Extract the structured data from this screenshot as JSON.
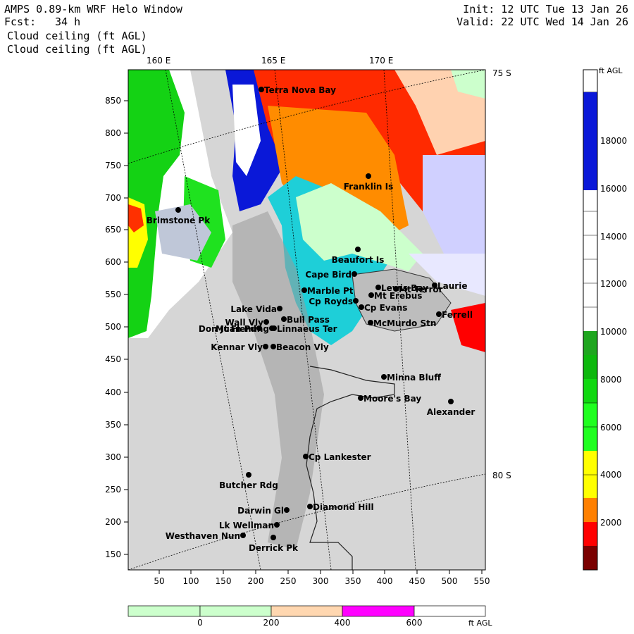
{
  "header": {
    "title": "AMPS 0.89-km WRF Helo Window",
    "forecast_label": "Fcst:",
    "forecast_hours": "34 h",
    "field_line1": "Cloud ceiling (ft AGL)",
    "field_line2": "Cloud ceiling (ft AGL)",
    "init": "Init: 12 UTC Tue 13 Jan 26",
    "valid": "Valid: 22 UTC Wed 14 Jan 26"
  },
  "map": {
    "lon_labels": [
      "160 E",
      "165 E",
      "170 E"
    ],
    "lat_labels": [
      "75 S",
      "80 S"
    ],
    "x_ticks": [
      "50",
      "100",
      "150",
      "200",
      "250",
      "300",
      "350",
      "400",
      "450",
      "500",
      "550"
    ],
    "y_ticks": [
      "850",
      "800",
      "750",
      "700",
      "650",
      "600",
      "550",
      "500",
      "450",
      "400",
      "350",
      "300",
      "250",
      "200",
      "150"
    ],
    "places": [
      {
        "name": "Terra Nova Bay"
      },
      {
        "name": "Franklin Is"
      },
      {
        "name": "Brimstone Pk"
      },
      {
        "name": "Beaufort Is"
      },
      {
        "name": "Cape Bird"
      },
      {
        "name": "Lewis Bay"
      },
      {
        "name": "Laurie"
      },
      {
        "name": "Marble Pt"
      },
      {
        "name": "Mt Terror"
      },
      {
        "name": "Cp Royds"
      },
      {
        "name": "Mt Erebus"
      },
      {
        "name": "Lake Vida"
      },
      {
        "name": "Cp Evans"
      },
      {
        "name": "Ferrell"
      },
      {
        "name": "Wall Vly"
      },
      {
        "name": "Bull Pass"
      },
      {
        "name": "McMurdo Stn"
      },
      {
        "name": "Don Juan Pd"
      },
      {
        "name": "Mt Fleming"
      },
      {
        "name": "Linnaeus Ter"
      },
      {
        "name": "Kennar Vly"
      },
      {
        "name": "Beacon Vly"
      },
      {
        "name": "Minna Bluff"
      },
      {
        "name": "Moore's Bay"
      },
      {
        "name": "Alexander"
      },
      {
        "name": "Cp Lankester"
      },
      {
        "name": "Butcher Rdg"
      },
      {
        "name": "Darwin Gl"
      },
      {
        "name": "Diamond Hill"
      },
      {
        "name": "Lk Wellman"
      },
      {
        "name": "Westhaven Nun"
      },
      {
        "name": "Derrick Pk"
      }
    ]
  },
  "colorbar": {
    "unit": "ft AGL",
    "tick_labels": [
      "18000",
      "16000",
      "14000",
      "12000",
      "10000",
      "8000",
      "6000",
      "4000",
      "2000"
    ],
    "colors": [
      "#0a18d8",
      "#ffffff",
      "#ffffff",
      "#ffffff",
      "#ffffff",
      "#1fa61f",
      "#0fc40f",
      "#0ee80e",
      "#1fff1f",
      "#ffff00",
      "#ff8000",
      "#ff0000",
      "#7a0000"
    ]
  },
  "bottom_bar": {
    "unit": "ft AGL",
    "tick_labels": [
      "0",
      "200",
      "400",
      "600"
    ],
    "colors": [
      "#ccffcc",
      "#ccffcc",
      "#ffd7b0",
      "#ff00ff",
      "#ffffff"
    ]
  }
}
